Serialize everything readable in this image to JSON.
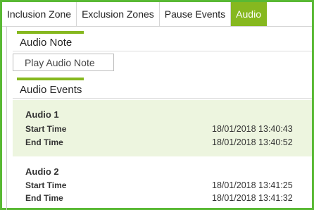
{
  "tabs": [
    {
      "label": "Inclusion Zone"
    },
    {
      "label": "Exclusion Zones"
    },
    {
      "label": "Pause Events"
    },
    {
      "label": "Audio",
      "active": true
    }
  ],
  "audio_note": {
    "title": "Audio Note",
    "play_button": "Play Audio Note"
  },
  "audio_events": {
    "title": "Audio Events",
    "events": [
      {
        "name": "Audio 1",
        "start_label": "Start Time",
        "start_value": "18/01/2018 13:40:43",
        "end_label": "End Time",
        "end_value": "18/01/2018 13:40:52"
      },
      {
        "name": "Audio 2",
        "start_label": "Start Time",
        "start_value": "18/01/2018 13:41:25",
        "end_label": "End Time",
        "end_value": "18/01/2018 13:41:32"
      }
    ]
  },
  "colors": {
    "accent": "#86b81f",
    "frame_border": "#59b934",
    "selected_row": "#edf5df"
  }
}
